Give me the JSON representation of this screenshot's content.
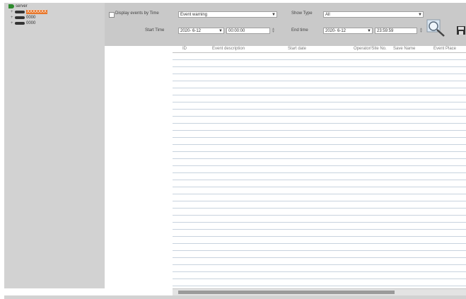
{
  "tree": {
    "root_label": "server",
    "items": [
      {
        "label": "XXXXXXX",
        "selected": true
      },
      {
        "label": "0000",
        "selected": false
      },
      {
        "label": "0000",
        "selected": false
      }
    ]
  },
  "toolbar": {
    "display_label": "Display events by Time",
    "event_type_value": "Event warning",
    "show_type_label": "Show Type",
    "show_type_value": "All",
    "start_time_label": "Start Time",
    "start_date": "2020- 6-12",
    "start_clock": "00:00:00",
    "end_time_label": "End time",
    "end_date": "2020- 6-12",
    "end_clock": "23:59:59"
  },
  "grid": {
    "columns": [
      "ID",
      "Event description",
      "Start date",
      "Operator/Site No.",
      "Save Name",
      "Event Place"
    ]
  }
}
